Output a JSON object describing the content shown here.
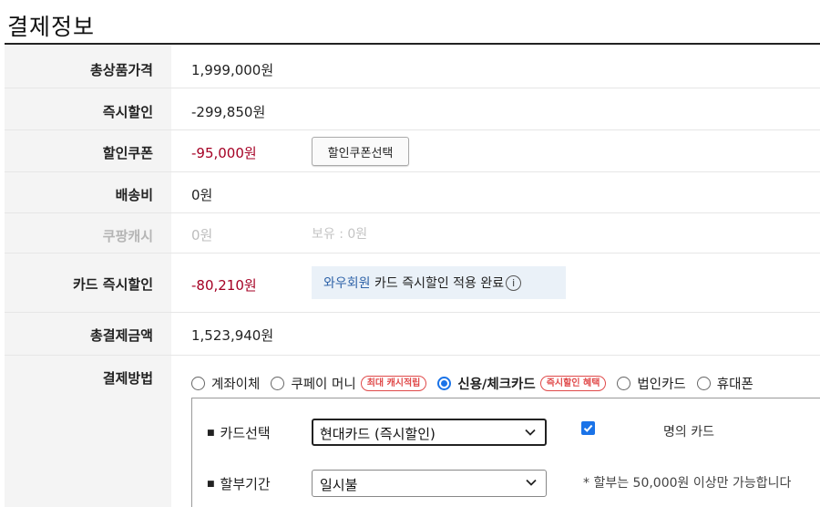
{
  "page_title": "결제정보",
  "rows": {
    "total_price": {
      "label": "총상품가격",
      "value": "1,999,000원"
    },
    "instant_discount": {
      "label": "즉시할인",
      "value": "-299,850원"
    },
    "coupon": {
      "label": "할인쿠폰",
      "value": "-95,000원",
      "button": "할인쿠폰선택"
    },
    "shipping": {
      "label": "배송비",
      "value": "0원"
    },
    "coupang_cash": {
      "label": "쿠팡캐시",
      "value": "0원",
      "holding": "보유 : 0원"
    },
    "card_discount": {
      "label": "카드 즉시할인",
      "value": "-80,210원",
      "notice_highlight": "와우회원",
      "notice_text": " 카드 즉시할인 적용 완료",
      "info_icon": "i"
    },
    "total_payment": {
      "label": "총결제금액",
      "value": "1,523,940원"
    },
    "payment_method": {
      "label": "결제방법",
      "options": [
        {
          "label": "계좌이체",
          "selected": false,
          "badge": ""
        },
        {
          "label": "쿠페이 머니",
          "selected": false,
          "badge": "최대 캐시적립"
        },
        {
          "label": "신용/체크카드",
          "selected": true,
          "badge": "즉시할인 혜택"
        },
        {
          "label": "법인카드",
          "selected": false,
          "badge": ""
        },
        {
          "label": "휴대폰",
          "selected": false,
          "badge": ""
        }
      ]
    }
  },
  "card_panel": {
    "card_select_label": "카드선택",
    "card_select_value": "현대카드 (즉시할인)",
    "owner_checked": true,
    "owner_suffix": "명의 카드",
    "installment_label": "할부기간",
    "installment_value": "일시불",
    "installment_note": "* 할부는 50,000원 이상만 가능합니다"
  },
  "colors": {
    "discount_red": "#a50024",
    "badge_red": "#e04a4a",
    "accent_blue": "#1a73e8",
    "wow_blue": "#2f63a8",
    "notice_bg": "#eaf1f8"
  },
  "icons": {
    "radio": "radio-icon",
    "info": "info-icon",
    "dropdown": "chevron-down-icon",
    "checkbox": "checkbox-icon"
  }
}
